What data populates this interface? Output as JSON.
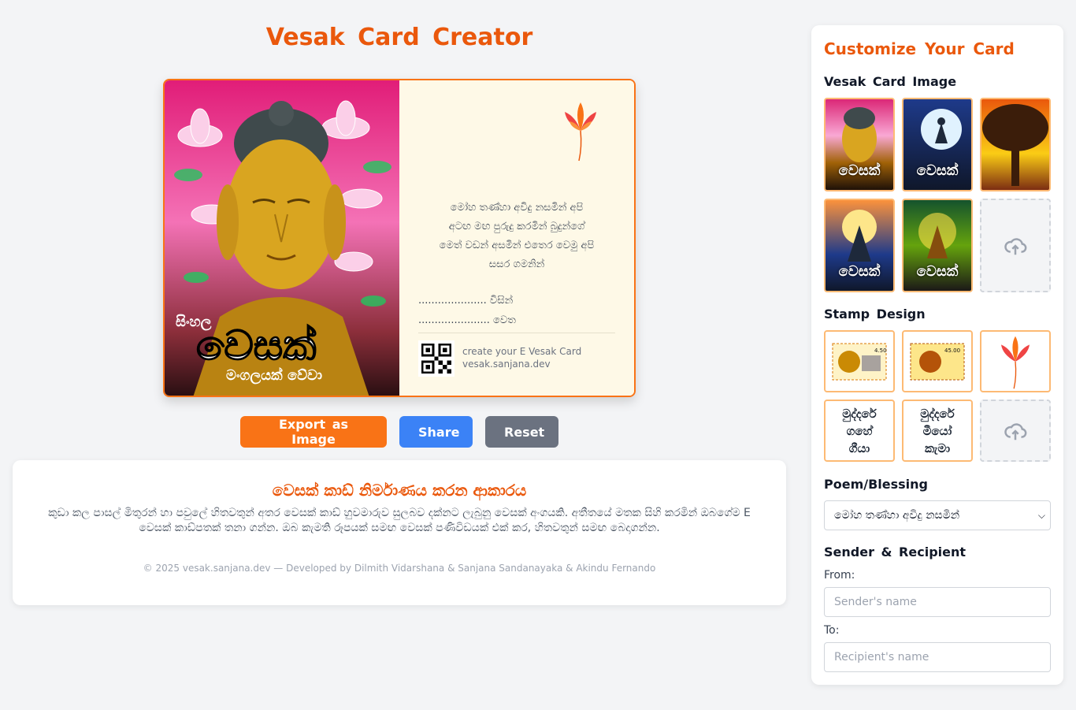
{
  "main": {
    "title": "Vesak Card Creator",
    "card": {
      "image_text_top": "සිංහල",
      "image_text_main": "වෙසක්",
      "image_text_bottom": "මංගලයක් වේවා",
      "poem_lines": [
        "මෝහ තණ්හා අවිදු නසමින් අපි",
        "අටඟ මඟ පුරුදු කරමින් බුදුන්ගේ",
        "මෙත් වඩන් අසමින් එතෙර වෙමු අපි",
        "සසර ගමනින්"
      ],
      "from_line": "..................... විසින්",
      "to_line": "...................... වෙත",
      "footer_line1": "create your E Vesak Card",
      "footer_line2": "vesak.sanjana.dev"
    },
    "buttons": {
      "export": "Export as Image",
      "share": "Share",
      "reset": "Reset"
    },
    "info": {
      "heading": "වෙසක් කාඩ් නිර්මාණය කරන ආකාරය",
      "body": "කුඩා කල පාසල් මිතුරන් හා පවුලේ හිතවතුන් අතර වෙසක් කාඩ් හුවමාරුව සුලබව දක්නට ලැබුනු වෙසක් අංගයකි. අතීතයේ මතක සිහි කරමින් ඔබගේම E වෙසක් කාඩ්පතක් තනා ගන්න. ඔබ කැමති රූපයක් සමඟ වෙසක් පණිවිඩයක් එක් කර, හිතවතුන් සමඟ බෙදාගන්න.",
      "credits": "© 2025 vesak.sanjana.dev — Developed by Dilmith Vidarshana & Sanjana Sandanayaka & Akindu Fernando"
    }
  },
  "sidebar": {
    "title": "Customize Your Card",
    "image_section": "Vesak Card Image",
    "thumb_word": "වෙසක්",
    "stamp_section": "Stamp Design",
    "stamp_prices": [
      "4.50",
      "45.00"
    ],
    "stamp_texts": [
      [
        "මුද්දරේ",
        "ගහේ",
        "ගීයා"
      ],
      [
        "මුද්දරේ",
        "මීයෝ",
        "කැමා"
      ]
    ],
    "poem_section": "Poem/Blessing",
    "poem_selected": "මෝහ තණ්හා අවිදු නසමින්",
    "sender_section": "Sender & Recipient",
    "from_label": "From:",
    "from_placeholder": "Sender's name",
    "to_label": "To:",
    "to_placeholder": "Recipient's name"
  },
  "colors": {
    "accent": "#ea580c",
    "export_button": "#f97316",
    "share_button": "#3b82f6",
    "reset_button": "#6b7280",
    "card_background": "#fef9e7"
  },
  "icons": {
    "upload": "cloud-upload-icon",
    "lotus": "lotus-flower-icon",
    "qr": "qr-code-icon",
    "dropdown": "chevron-down-icon"
  }
}
